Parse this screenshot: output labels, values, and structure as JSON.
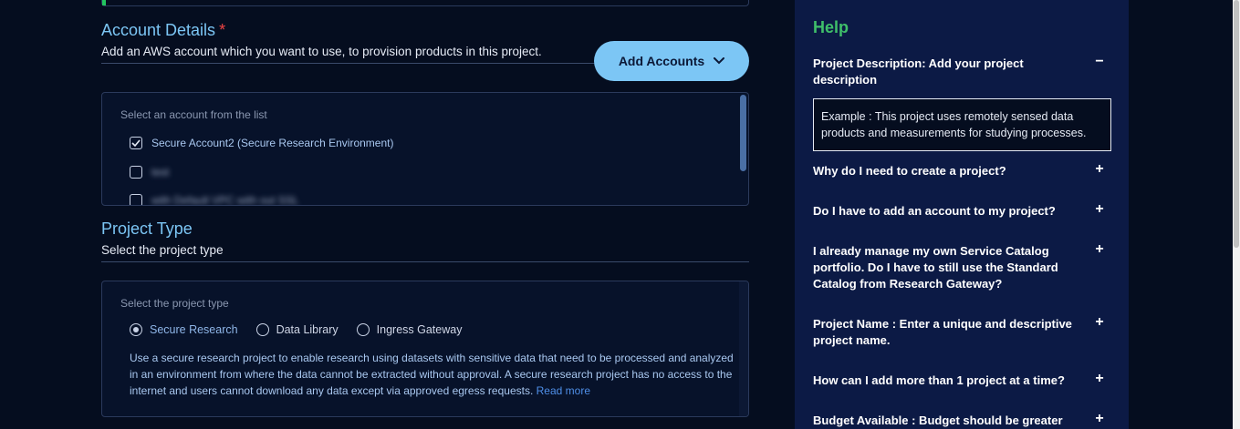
{
  "account_section": {
    "title": "Account Details",
    "required_mark": "*",
    "subtitle": "Add an AWS account which you want to use, to provision products in this project.",
    "add_button_label": "Add Accounts",
    "list_label": "Select an account from the list",
    "accounts": [
      {
        "label": "Secure Account2 (Secure Research Environment)",
        "checked": true
      },
      {
        "label": "test",
        "checked": false
      },
      {
        "label": "with Default VPC with out SSL",
        "checked": false
      }
    ]
  },
  "project_type_section": {
    "title": "Project Type",
    "subtitle": "Select the project type",
    "list_label": "Select the project type",
    "options": [
      {
        "label": "Secure Research",
        "selected": true
      },
      {
        "label": "Data Library",
        "selected": false
      },
      {
        "label": "Ingress Gateway",
        "selected": false
      }
    ],
    "description": "Use a secure research project to enable research using datasets with sensitive data that need to be processed and analyzed in an environment from where the data cannot be extracted without approval. A secure research project has no access to the internet and users cannot download any data except via approved egress requests.",
    "read_more": "Read more"
  },
  "help": {
    "title": "Help",
    "items": [
      {
        "question": "Project Description: Add your project description",
        "toggle": "−",
        "expanded": true,
        "answer": "Example : This project uses remotely sensed data products and measurements for studying processes."
      },
      {
        "question": "Why do I need to create a project?",
        "toggle": "+"
      },
      {
        "question": "Do I have to add an account to my project?",
        "toggle": "+"
      },
      {
        "question": "I already manage my own Service Catalog portfolio. Do I have to still use the Standard Catalog from Research Gateway?",
        "toggle": "+"
      },
      {
        "question": "Project Name : Enter a unique and descriptive project name.",
        "toggle": "+"
      },
      {
        "question": "How can I add more than 1 project at a time?",
        "toggle": "+"
      },
      {
        "question": "Budget Available : Budget should be greater",
        "toggle": "+"
      }
    ]
  },
  "colors": {
    "background": "#050d1f",
    "accent": "#7cc6f5",
    "help_bg": "#0c1a45",
    "help_title": "#3fbf6a",
    "required": "#ef4444"
  }
}
